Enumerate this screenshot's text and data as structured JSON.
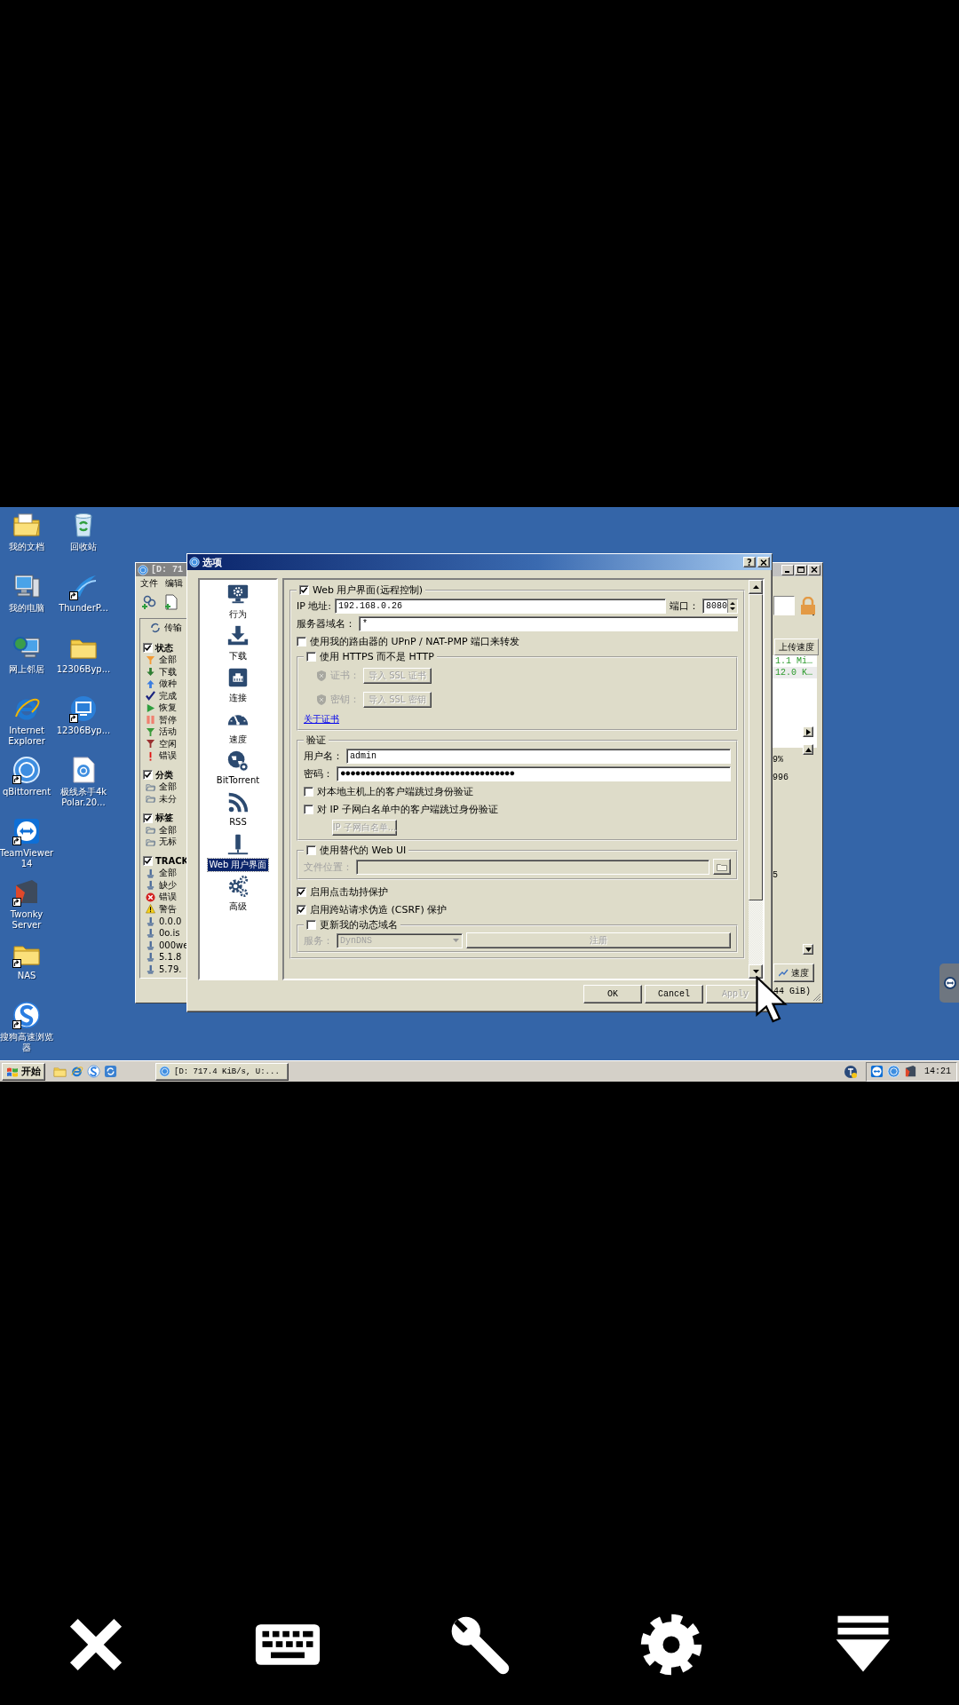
{
  "desktop": {
    "icon_columns": [
      [
        {
          "label": "我的文档",
          "kind": "docs",
          "shortcut": false
        },
        {
          "label": "我的电脑",
          "kind": "computer",
          "shortcut": false
        },
        {
          "label": "网上邻居",
          "kind": "network",
          "shortcut": false
        },
        {
          "label": "Internet Explorer",
          "kind": "ie",
          "shortcut": false
        },
        {
          "label": "qBittorrent",
          "kind": "qb",
          "shortcut": true
        },
        {
          "label": "TeamViewer 14",
          "kind": "teamviewer",
          "shortcut": true
        },
        {
          "label": "Twonky Server",
          "kind": "twonky",
          "shortcut": true
        },
        {
          "label": "NAS",
          "kind": "folder",
          "shortcut": true
        },
        {
          "label": "搜狗高速浏览器",
          "kind": "sogou",
          "shortcut": true
        }
      ],
      [
        {
          "label": "回收站",
          "kind": "recycle",
          "shortcut": false
        },
        {
          "label": "ThunderP...",
          "kind": "bird",
          "shortcut": true
        },
        {
          "label": "12306Byp...",
          "kind": "folder",
          "shortcut": false
        },
        {
          "label": "12306Byp...",
          "kind": "monitor-app",
          "shortcut": true
        },
        {
          "label": "极线杀手4k Polar.20...",
          "kind": "qb-file",
          "shortcut": false
        }
      ]
    ]
  },
  "torrent_window": {
    "title": "[D: 71",
    "menu": [
      "文件",
      "编辑"
    ],
    "transfer_tab": "传输",
    "filter_sections": [
      {
        "title": "状态",
        "checked": true,
        "items": [
          {
            "label": "全部",
            "kind": "funnel-orange"
          },
          {
            "label": "下载",
            "kind": "arrow-down"
          },
          {
            "label": "做种",
            "kind": "arrow-up"
          },
          {
            "label": "完成",
            "kind": "check"
          },
          {
            "label": "恢复",
            "kind": "play"
          },
          {
            "label": "暂停",
            "kind": "pause"
          },
          {
            "label": "活动",
            "kind": "funnel-green"
          },
          {
            "label": "空闲",
            "kind": "funnel-red"
          },
          {
            "label": "错误",
            "kind": "exclaim"
          }
        ]
      },
      {
        "title": "分类",
        "checked": true,
        "items": [
          {
            "label": "全部",
            "kind": "folder-outline"
          },
          {
            "label": "未分",
            "kind": "folder-outline"
          }
        ]
      },
      {
        "title": "标签",
        "checked": true,
        "items": [
          {
            "label": "全部",
            "kind": "folder-outline"
          },
          {
            "label": "无标",
            "kind": "folder-outline"
          }
        ]
      },
      {
        "title": "TRACK",
        "checked": true,
        "items": [
          {
            "label": "全部",
            "kind": "tracker"
          },
          {
            "label": "缺少",
            "kind": "tracker"
          },
          {
            "label": "错误",
            "kind": "error"
          },
          {
            "label": "警告",
            "kind": "warning"
          },
          {
            "label": "0.0.0",
            "kind": "tracker"
          },
          {
            "label": "0o.is",
            "kind": "tracker"
          },
          {
            "label": "000we",
            "kind": "tracker"
          },
          {
            "label": "5.1.8",
            "kind": "tracker"
          },
          {
            "label": "5.79.",
            "kind": "tracker"
          }
        ]
      }
    ],
    "table_header": "上传速度",
    "table_rows": [
      "1.1 Mi…",
      "12.0 K…"
    ],
    "details": [
      "9%",
      "996",
      "5"
    ],
    "speed_tab": "速度",
    "status_text": "44 GiB)"
  },
  "dialog": {
    "title": "选项",
    "help_label": "?",
    "categories": [
      {
        "label": "行为",
        "kind": "behavior",
        "selected": false
      },
      {
        "label": "下载",
        "kind": "download",
        "selected": false
      },
      {
        "label": "连接",
        "kind": "connection",
        "selected": false
      },
      {
        "label": "速度",
        "kind": "speed",
        "selected": false
      },
      {
        "label": "BitTorrent",
        "kind": "bittorrent",
        "selected": false
      },
      {
        "label": "RSS",
        "kind": "rss",
        "selected": false
      },
      {
        "label": "Web 用户界面",
        "kind": "webui",
        "selected": true
      },
      {
        "label": "高级",
        "kind": "advanced",
        "selected": false
      }
    ],
    "web_ui": {
      "enabled": {
        "label": "Web 用户界面(远程控制)",
        "checked": true
      },
      "ip_label": "IP 地址:",
      "ip_value": "192.168.0.26",
      "port_label": "端口：",
      "port_value": "8080",
      "domain_label": "服务器域名：",
      "domain_value": "*",
      "upnp": {
        "label": "使用我的路由器的 UPnP / NAT-PMP 端口来转发",
        "checked": false
      },
      "https": {
        "label": "使用 HTTPS 而不是 HTTP",
        "checked": false,
        "cert_label": "证书：",
        "cert_button": "导入 SSL 证书",
        "key_label": "密钥：",
        "key_button": "导入 SSL 密钥",
        "link": "关于证书"
      },
      "auth": {
        "title": "验证",
        "user_label": "用户名：",
        "user_value": "admin",
        "pass_label": "密码：",
        "pass_value": "●●●●●●●●●●●●●●●●●●●●●●●●●●●●●●●●●●●",
        "options": [
          {
            "label": "对本地主机上的客户端跳过身份验证",
            "checked": false
          },
          {
            "label": "对 IP 子网白名单中的客户端跳过身份验证",
            "checked": false
          }
        ],
        "whitelist_button": "IP 子网白名单..."
      },
      "alt_ui": {
        "label": "使用替代的 Web UI",
        "checked": false,
        "location_label": "文件位置："
      },
      "protections": [
        {
          "label": "启用点击劫持保护",
          "checked": true
        },
        {
          "label": "启用跨站请求伪造 (CSRF) 保护",
          "checked": true
        }
      ],
      "dyndns": {
        "label": "更新我的动态域名",
        "checked": false,
        "service_label": "服务：",
        "service_value": "DynDNS",
        "register_button": "注册"
      }
    },
    "buttons": [
      {
        "label": "OK",
        "disabled": false
      },
      {
        "label": "Cancel",
        "disabled": false
      },
      {
        "label": "Apply",
        "disabled": true
      }
    ]
  },
  "taskbar": {
    "start": "开始",
    "quick_launch": [
      {
        "kind": "folder"
      },
      {
        "kind": "ie"
      },
      {
        "kind": "sogou"
      },
      {
        "kind": "sync"
      }
    ],
    "task": "[D: 717.4 KiB/s, U:...",
    "tray": [
      {
        "kind": "teamviewer"
      },
      {
        "kind": "qb"
      },
      {
        "kind": "twonky"
      }
    ],
    "clock": "14:21"
  },
  "remote_toolbar": [
    {
      "kind": "close"
    },
    {
      "kind": "keyboard"
    },
    {
      "kind": "wrench"
    },
    {
      "kind": "settings"
    },
    {
      "kind": "collapse"
    }
  ]
}
